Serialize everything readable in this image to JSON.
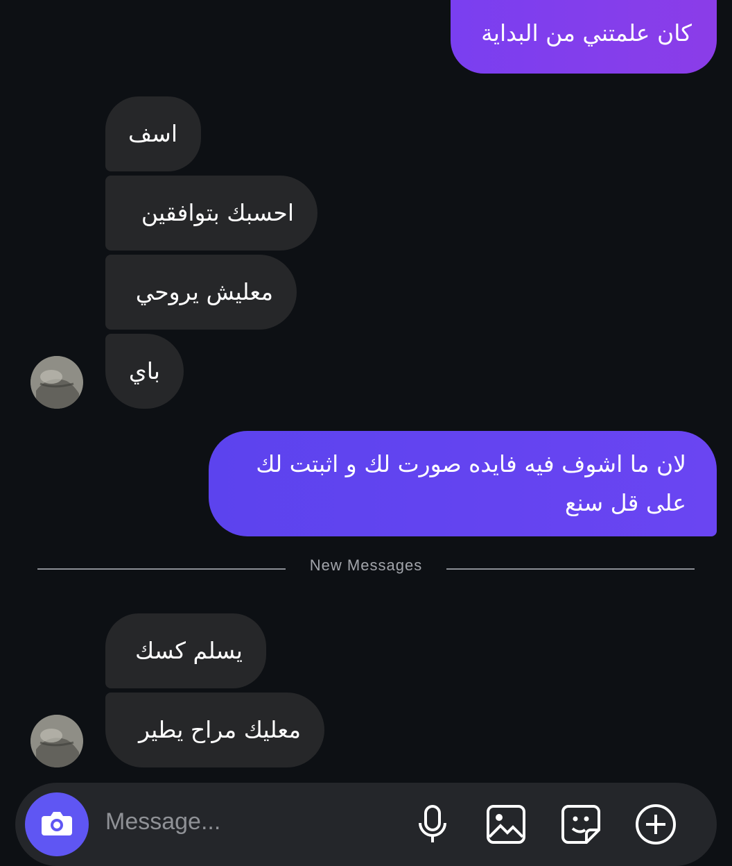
{
  "colors": {
    "background": "#0d1014",
    "incoming_bubble": "#262729",
    "outgoing_top_gradient": [
      "#7a3ff0",
      "#8b3de8"
    ],
    "outgoing_bottom_gradient": [
      "#6a45f2",
      "#5c43ee"
    ],
    "accent": "#5f56f3",
    "divider": "#8c8f96"
  },
  "messages": [
    {
      "direction": "outgoing",
      "text": "كان علمتني من البداية"
    },
    {
      "direction": "incoming",
      "text": "اسف"
    },
    {
      "direction": "incoming",
      "text": "احسبك بتوافقين"
    },
    {
      "direction": "incoming",
      "text": "معليش يروحي"
    },
    {
      "direction": "incoming",
      "text": "باي"
    },
    {
      "direction": "outgoing",
      "text": "لان ما اشوف فيه فايده صورت لك و اثبتت لك",
      "text_line2": "على قل سنع"
    },
    {
      "direction": "incoming",
      "text": "يسلم كسك"
    },
    {
      "direction": "incoming",
      "text": "معليك مراح يطير"
    }
  ],
  "divider": {
    "label": "New Messages"
  },
  "composer": {
    "placeholder": "Message...",
    "icons": [
      "camera-icon",
      "microphone-icon",
      "gallery-icon",
      "sticker-icon",
      "add-icon"
    ]
  }
}
